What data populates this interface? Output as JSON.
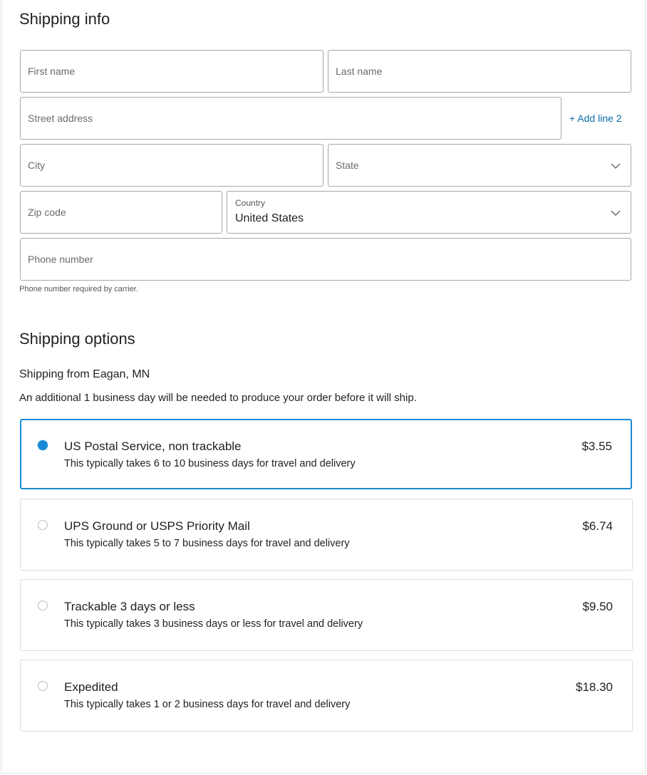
{
  "shipping_info": {
    "title": "Shipping info",
    "first_name": {
      "placeholder": "First name",
      "value": ""
    },
    "last_name": {
      "placeholder": "Last name",
      "value": ""
    },
    "street": {
      "placeholder": "Street address",
      "value": ""
    },
    "add_line_label": "+ Add line 2",
    "city": {
      "placeholder": "City",
      "value": ""
    },
    "state": {
      "label": "State",
      "value": ""
    },
    "zip": {
      "placeholder": "Zip code",
      "value": ""
    },
    "country": {
      "label": "Country",
      "value": "United States"
    },
    "phone": {
      "placeholder": "Phone number",
      "value": ""
    },
    "phone_hint": "Phone number required by carrier."
  },
  "shipping_options": {
    "title": "Shipping options",
    "ship_from": "Shipping from Eagan, MN",
    "note": "An additional 1 business day will be needed to produce your order before it will ship.",
    "accent_color": "#1a8ad4",
    "selected_index": 0,
    "options": [
      {
        "name": "US Postal Service, non trackable",
        "description": "This typically takes 6 to 10 business days for travel and delivery",
        "price": "$3.55"
      },
      {
        "name": "UPS Ground or USPS Priority Mail",
        "description": "This typically takes 5 to 7 business days for travel and delivery",
        "price": "$6.74"
      },
      {
        "name": "Trackable 3 days or less",
        "description": "This typically takes 3 business days or less for travel and delivery",
        "price": "$9.50"
      },
      {
        "name": "Expedited",
        "description": "This typically takes 1 or 2 business days for travel and delivery",
        "price": "$18.30"
      }
    ]
  },
  "icons": {
    "dropdown": "chevron-down-icon",
    "radio_on": "radio-selected-icon",
    "radio_off": "radio-unselected-icon"
  }
}
